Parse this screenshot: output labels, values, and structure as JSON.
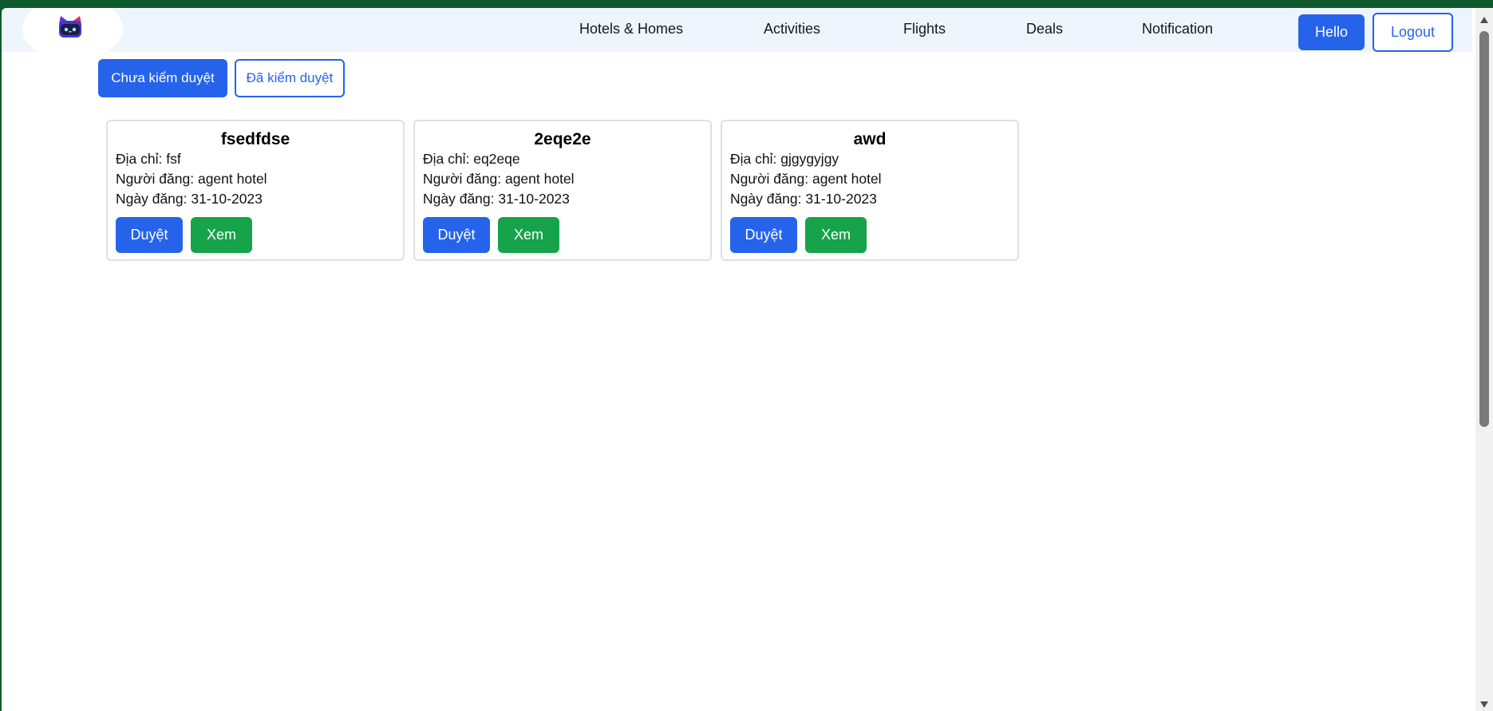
{
  "nav": {
    "links": [
      "Hotels & Homes",
      "Activities",
      "Flights",
      "Deals",
      "Notification"
    ],
    "hello_label": "Hello",
    "logout_label": "Logout"
  },
  "tabs": {
    "unreviewed": "Chưa kiểm duyệt",
    "reviewed": "Đã kiểm duyệt"
  },
  "cards": [
    {
      "name": "fsedfdse",
      "address": "Địa chỉ: fsf",
      "poster": "Người đăng: agent hotel",
      "date": "Ngày đăng: 31-10-2023",
      "approve_label": "Duyệt",
      "view_label": "Xem"
    },
    {
      "name": "2eqe2e",
      "address": "Địa chỉ: eq2eqe",
      "poster": "Người đăng: agent hotel",
      "date": "Ngày đăng: 31-10-2023",
      "approve_label": "Duyệt",
      "view_label": "Xem"
    },
    {
      "name": "awd",
      "address": "Địa chỉ: gjgygyjgy",
      "poster": "Người đăng: agent hotel",
      "date": "Ngày đăng: 31-10-2023",
      "approve_label": "Duyệt",
      "view_label": "Xem"
    }
  ],
  "colors": {
    "primary": "#2563eb",
    "success": "#16a34a",
    "nav_bg": "#eef5fd",
    "frame": "#0e5a2c"
  },
  "icons": {
    "logo": "cat-logo-icon",
    "scroll_up": "arrow-up-icon",
    "scroll_down": "arrow-down-icon"
  }
}
